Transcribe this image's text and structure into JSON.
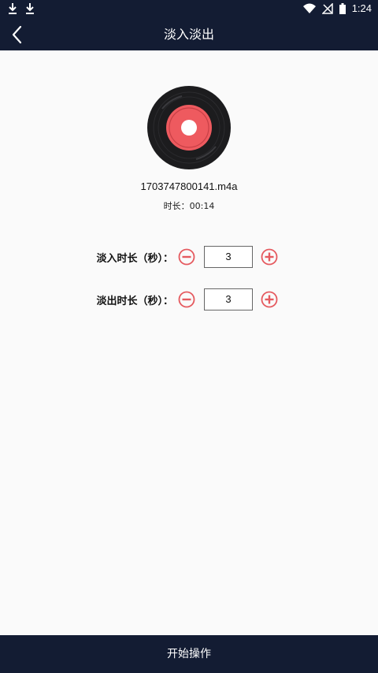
{
  "status_bar": {
    "time": "1:24",
    "left_icons": [
      "download-icon",
      "download-icon"
    ],
    "right_icons": [
      "wifi-icon",
      "signal-off-icon",
      "battery-icon"
    ]
  },
  "app_bar": {
    "title": "淡入淡出",
    "back_icon": "chevron-left-icon",
    "background": "#131c33"
  },
  "media": {
    "file_name": "1703747800141.m4a",
    "duration_label": "时长：00:14",
    "disc_color": "#ee5a5f"
  },
  "fade_in": {
    "label": "淡入时长（秒）：",
    "value": "3"
  },
  "fade_out": {
    "label": "淡出时长（秒）：",
    "value": "3"
  },
  "accent_color": "#e55a5f",
  "action": {
    "label": "开始操作"
  }
}
